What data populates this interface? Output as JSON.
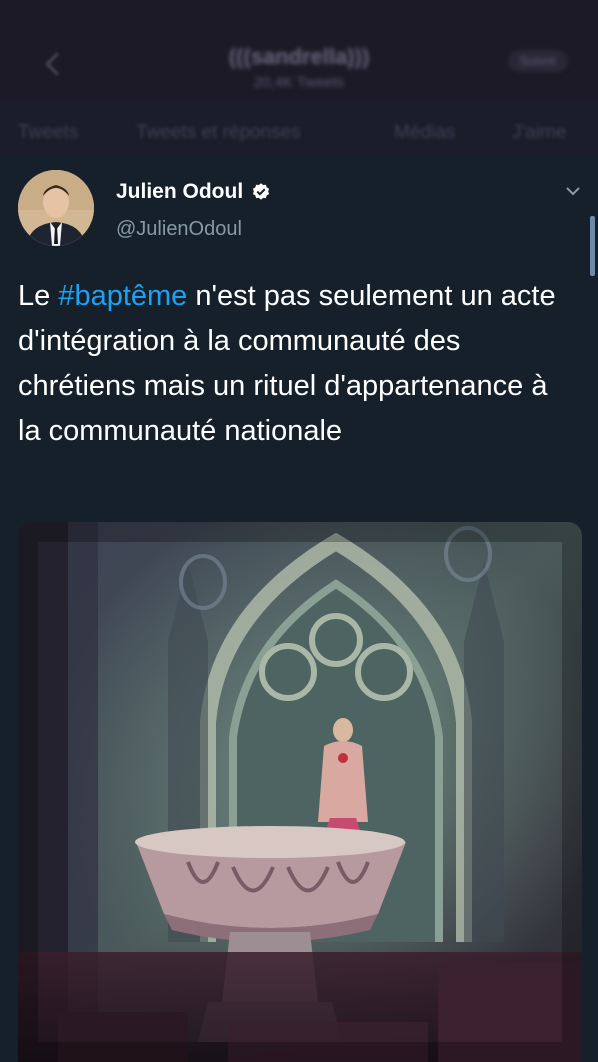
{
  "header": {
    "title": "(((sandrella)))",
    "subtitle": "20,4K Tweets",
    "follow_label": "Suivre"
  },
  "tabs": [
    {
      "label": "Tweets"
    },
    {
      "label": "Tweets et réponses"
    },
    {
      "label": "Médias"
    },
    {
      "label": "J'aime"
    }
  ],
  "tweet": {
    "author_name": "Julien Odoul",
    "author_handle": "@JulienOdoul",
    "text_before": "Le ",
    "hashtag": "#baptême",
    "text_after": " n'est pas seulement un acte d'intégration à la communauté des chrétiens mais un rituel d'appartenance à la communauté nationale",
    "media_description_icon": "church-baptismal-font-photo"
  },
  "colors": {
    "background": "#15202b",
    "accent": "#1da1f2",
    "secondary_text": "#8899a6"
  }
}
